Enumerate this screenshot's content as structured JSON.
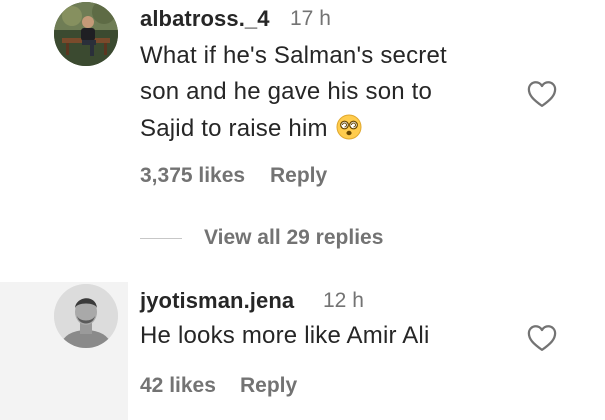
{
  "comments": [
    {
      "username": "albatross._4",
      "time": "17 h",
      "text_lines": [
        "What if he's Salman's secret",
        "son and he gave his son to",
        "Sajid to raise him"
      ],
      "emoji": "face-with-spiral-eyes-emoji",
      "likes": "3,375 likes",
      "reply_label": "Reply",
      "avatar": "avatar-man-on-bench",
      "like_icon": "heart-outline-icon"
    },
    {
      "username": "jyotisman.jena",
      "time": "12 h",
      "text_lines": [
        "He looks more like Amir Ali"
      ],
      "likes": "42 likes",
      "reply_label": "Reply",
      "avatar": "avatar-man-portrait-grey",
      "like_icon": "heart-outline-icon"
    }
  ],
  "view_replies": {
    "label": "View all 29 replies"
  },
  "colors": {
    "primary_text": "#262626",
    "secondary_text": "#737373",
    "divider": "#c7c7c7"
  }
}
